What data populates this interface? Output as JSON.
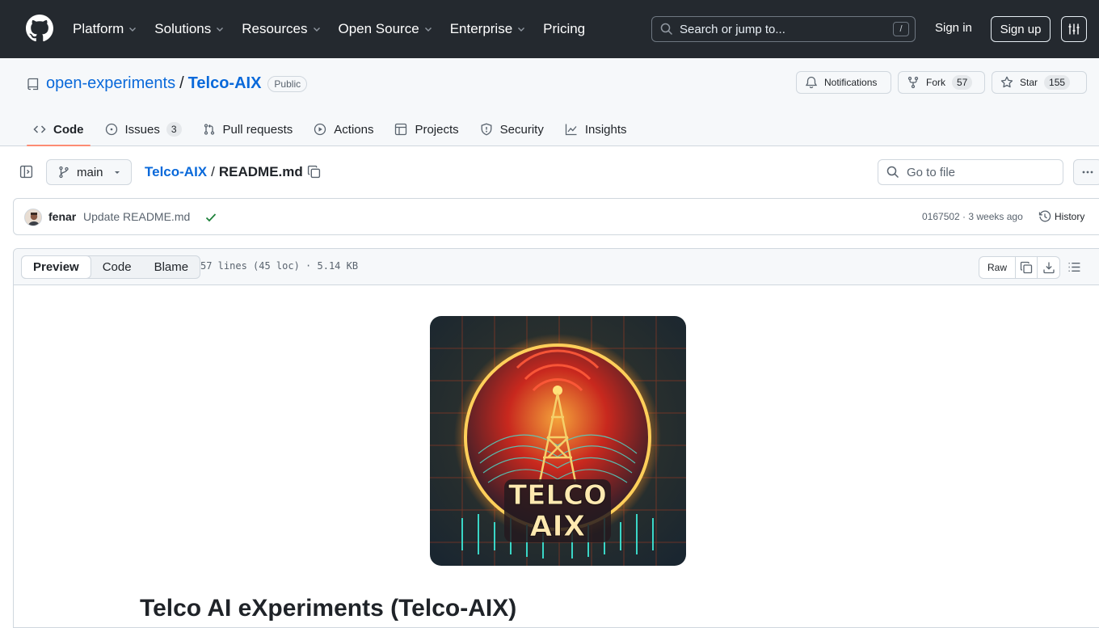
{
  "nav": {
    "items": [
      "Platform",
      "Solutions",
      "Resources",
      "Open Source",
      "Enterprise",
      "Pricing"
    ],
    "search_placeholder": "Search or jump to...",
    "search_shortcut": "/",
    "sign_in": "Sign in",
    "sign_up": "Sign up"
  },
  "repo": {
    "owner": "open-experiments",
    "separator": "/",
    "name": "Telco-AIX",
    "visibility": "Public",
    "notifications_label": "Notifications",
    "fork_label": "Fork",
    "fork_count": "57",
    "star_label": "Star",
    "star_count": "155"
  },
  "tabs": [
    {
      "label": "Code",
      "icon": "code-icon",
      "selected": true
    },
    {
      "label": "Issues",
      "icon": "issue-opened-icon",
      "count": "3"
    },
    {
      "label": "Pull requests",
      "icon": "git-pull-request-icon"
    },
    {
      "label": "Actions",
      "icon": "play-icon"
    },
    {
      "label": "Projects",
      "icon": "table-icon"
    },
    {
      "label": "Security",
      "icon": "shield-icon"
    },
    {
      "label": "Insights",
      "icon": "graph-icon"
    }
  ],
  "file": {
    "branch": "main",
    "repo_crumb": "Telco-AIX",
    "separator": "/",
    "filename": "README.md",
    "goto_placeholder": "Go to file"
  },
  "commit": {
    "author": "fenar",
    "message": "Update README.md",
    "sha_time": "0167502 · 3 weeks ago",
    "history_label": "History"
  },
  "viewer": {
    "modes": [
      "Preview",
      "Code",
      "Blame"
    ],
    "active_mode": "Preview",
    "stats": "57 lines (45 loc) · 5.14 KB",
    "raw_label": "Raw"
  },
  "readme": {
    "logo_text_line1": "TELCO",
    "logo_text_line2": "AIX",
    "heading": "Telco AI eXperiments (Telco-AIX)"
  },
  "colors": {
    "header_bg": "#24292f",
    "link": "#0969da",
    "tab_underline": "#fd8c73",
    "success": "#1a7f37"
  }
}
